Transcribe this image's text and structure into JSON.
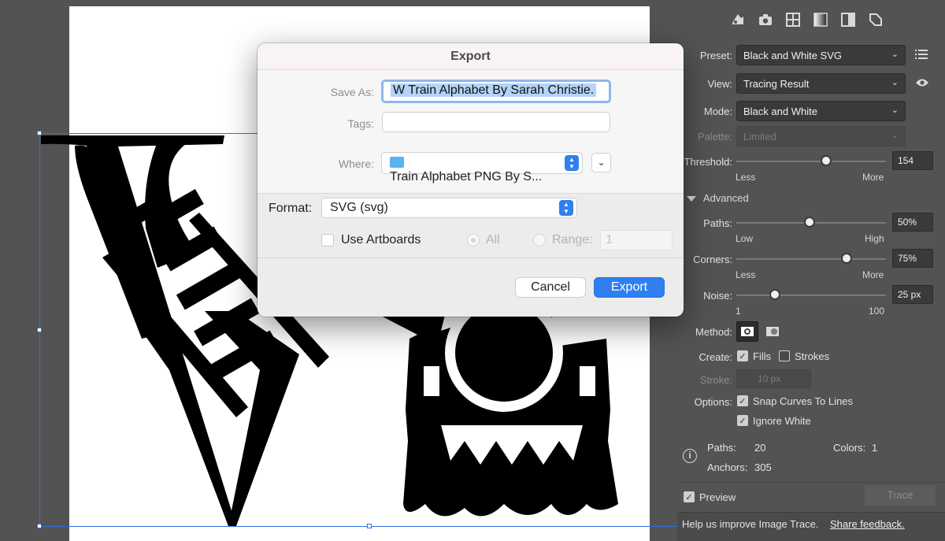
{
  "export_dialog": {
    "title": "Export",
    "save_as_label": "Save As:",
    "save_as_value": "W Train Alphabet By Sarah Christie.",
    "tags_label": "Tags:",
    "tags_value": "",
    "where_label": "Where:",
    "where_value": "Train Alphabet PNG By S...",
    "format_label": "Format:",
    "format_value": "SVG (svg)",
    "use_artboards_label": "Use Artboards",
    "use_artboards_checked": false,
    "all_label": "All",
    "range_label": "Range:",
    "range_value": "1",
    "cancel_label": "Cancel",
    "export_label": "Export",
    "accent_color": "#2f7ff0"
  },
  "trace_panel": {
    "top_icons": [
      "auto-color-icon",
      "camera-icon",
      "grid-icon",
      "gradient-icon",
      "half-square-icon",
      "shape-icon"
    ],
    "preset_label": "Preset:",
    "preset_value": "Black and White SVG",
    "view_label": "View:",
    "view_value": "Tracing Result",
    "mode_label": "Mode:",
    "mode_value": "Black and White",
    "palette_label": "Palette:",
    "palette_value": "Limited",
    "threshold_label": "Threshold:",
    "threshold_value": "154",
    "threshold_level": 0.59,
    "threshold_min_label": "Less",
    "threshold_max_label": "More",
    "advanced_label": "Advanced",
    "paths_label": "Paths:",
    "paths_value": "50%",
    "paths_level": 0.5,
    "paths_min_label": "Low",
    "paths_max_label": "High",
    "corners_label": "Corners:",
    "corners_value": "75%",
    "corners_level": 0.75,
    "corners_min_label": "Less",
    "corners_max_label": "More",
    "noise_label": "Noise:",
    "noise_value": "25 px",
    "noise_level": 0.25,
    "noise_min_label": "1",
    "noise_max_label": "100",
    "method_label": "Method:",
    "create_label": "Create:",
    "fills_label": "Fills",
    "fills_checked": true,
    "strokes_label": "Strokes",
    "strokes_checked": false,
    "stroke_label": "Stroke:",
    "stroke_value": "10 px",
    "options_label": "Options:",
    "snap_label": "Snap Curves To Lines",
    "snap_checked": true,
    "ignore_white_label": "Ignore White",
    "ignore_white_checked": true,
    "info_paths_label": "Paths:",
    "info_paths_value": "20",
    "info_colors_label": "Colors:",
    "info_colors_value": "1",
    "info_anchors_label": "Anchors:",
    "info_anchors_value": "305",
    "preview_label": "Preview",
    "preview_checked": true,
    "trace_button_label": "Trace",
    "help_text": "Help us improve Image Trace.",
    "feedback_link": "Share feedback."
  }
}
